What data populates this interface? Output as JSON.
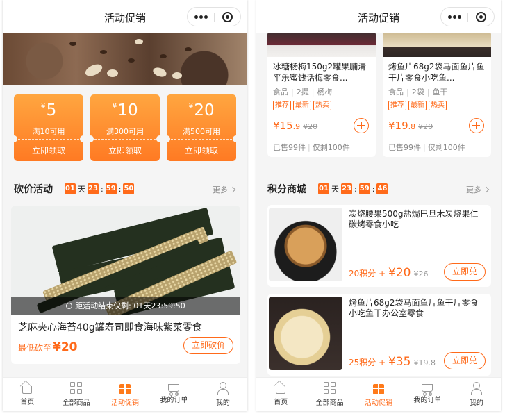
{
  "header": {
    "title": "活动促销"
  },
  "tabbar": [
    {
      "label": "首页",
      "icon": "home-icon"
    },
    {
      "label": "全部商品",
      "icon": "grid-icon"
    },
    {
      "label": "活动促销",
      "icon": "gift-icon",
      "active": true
    },
    {
      "label": "我的订单",
      "icon": "cart-icon"
    },
    {
      "label": "我的",
      "icon": "user-icon"
    }
  ],
  "coupons": [
    {
      "symbol": "¥",
      "amount": "5",
      "condition": "满10可用",
      "action": "立即领取"
    },
    {
      "symbol": "¥",
      "amount": "10",
      "condition": "满300可用",
      "action": "立即领取"
    },
    {
      "symbol": "¥",
      "amount": "20",
      "condition": "满500可用",
      "action": "立即领取"
    }
  ],
  "bargain": {
    "section_title": "砍价活动",
    "countdown": {
      "days": "01",
      "day_unit": "天",
      "hours": "23",
      "minutes": "59",
      "seconds": "50"
    },
    "more": "更多",
    "end_notice": "距活动结束仅剩: 01天23:59:50",
    "product_name": "芝麻夹心海苔40g罐寿司即食海味紫菜零食",
    "lowest_label": "最低砍至",
    "lowest_price": "¥20",
    "button": "立即砍价"
  },
  "products": [
    {
      "name": "冰糖杨梅150g2罐果脯清平乐蜜饯话梅零食...",
      "attrs": [
        "食品",
        "2提",
        "杨梅"
      ],
      "tags": [
        "推荐",
        "最新",
        "热卖"
      ],
      "price_int": "¥15",
      "price_dec": ".9",
      "old_price": "¥20",
      "sold": "已售99件",
      "remain": "仅剩100件"
    },
    {
      "name": "烤鱼片68g2袋马面鱼片鱼干片零食小吃鱼...",
      "attrs": [
        "食品",
        "2袋",
        "鱼干"
      ],
      "tags": [
        "推荐",
        "最新",
        "热卖"
      ],
      "price_int": "¥19",
      "price_dec": ".8",
      "old_price": "¥20",
      "sold": "已售99件",
      "remain": "仅剩100件"
    }
  ],
  "points_mall": {
    "section_title": "积分商城",
    "countdown": {
      "days": "01",
      "day_unit": "天",
      "hours": "23",
      "minutes": "59",
      "seconds": "46"
    },
    "more": "更多",
    "items": [
      {
        "name": "炭烧腰果500g盐焗巴旦木炭烧果仁碳烤零食小吃",
        "points": "20积分",
        "plus": "+",
        "price": "¥20",
        "old_price": "¥26",
        "button": "立即兑"
      },
      {
        "name": "烤鱼片68g2袋马面鱼片鱼干片零食小吃鱼干办公室零食",
        "points": "25积分",
        "plus": "+",
        "price": "¥35",
        "old_price": "¥19.8",
        "button": "立即兑"
      }
    ]
  },
  "colors": {
    "accent": "#ff6a1a",
    "coupon_top": "#ffa640",
    "coupon_bottom": "#ff7a23"
  }
}
